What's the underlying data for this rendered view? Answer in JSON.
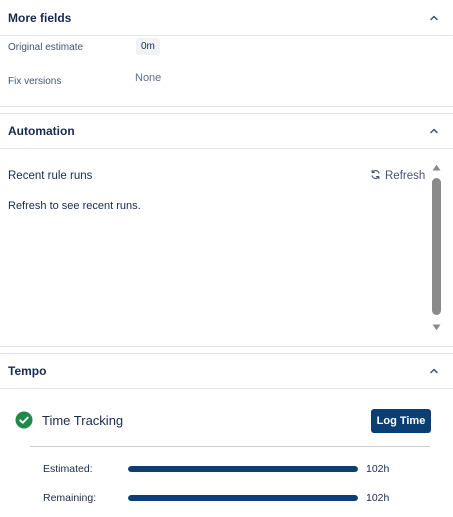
{
  "more_fields": {
    "title": "More fields",
    "original_estimate_label": "Original estimate",
    "original_estimate_value": "0m",
    "fix_versions_label": "Fix versions",
    "fix_versions_value": "None"
  },
  "automation": {
    "title": "Automation",
    "recent_rule_runs_label": "Recent rule runs",
    "refresh_label": "Refresh",
    "empty_message": "Refresh to see recent runs."
  },
  "tempo": {
    "title": "Tempo",
    "time_tracking_label": "Time Tracking",
    "log_time_label": "Log Time",
    "estimated_label": "Estimated:",
    "estimated_value": "102h",
    "estimated_progress": 1.0,
    "remaining_label": "Remaining:",
    "remaining_value": "102h",
    "remaining_progress": 1.0
  },
  "colors": {
    "accent": "#0b3f73",
    "success": "#1f8a4c",
    "text": "#172b4d"
  },
  "icons": {
    "collapse": "chevron-up-icon",
    "refresh": "refresh-icon",
    "check": "check-circle-icon"
  }
}
